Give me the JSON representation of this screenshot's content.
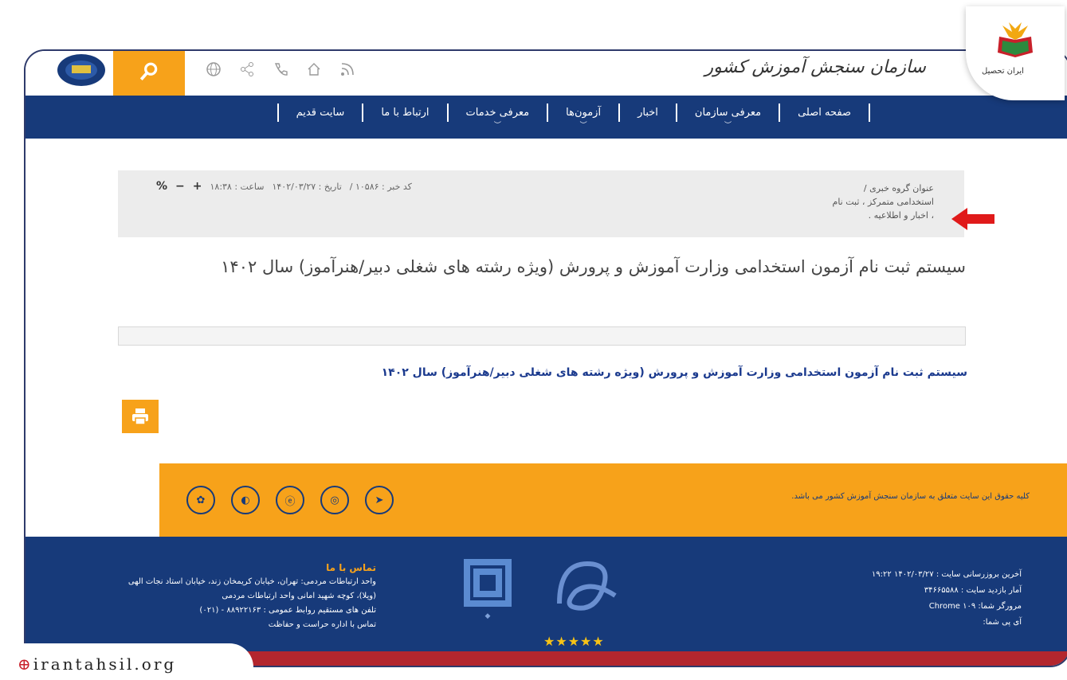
{
  "header": {
    "org_title": "سازمان سنجش آموزش کشور",
    "icons": [
      "globe-icon",
      "share-icon",
      "phone-icon",
      "home-icon",
      "rss-icon"
    ]
  },
  "nav": {
    "items": [
      {
        "label": "صفحه اصلی",
        "has_dropdown": false
      },
      {
        "label": "معرفی سازمان",
        "has_dropdown": true
      },
      {
        "label": "اخبار",
        "has_dropdown": false
      },
      {
        "label": "آزمون‌ها",
        "has_dropdown": true
      },
      {
        "label": "معرفی خدمات",
        "has_dropdown": true
      },
      {
        "label": "ارتباط با ما",
        "has_dropdown": false
      },
      {
        "label": "سایت قدیم",
        "has_dropdown": false
      }
    ]
  },
  "info": {
    "group_line1": "عنوان گروه خبری /",
    "group_line2": "استخدامی متمرکز ، ثبت نام",
    "group_line3": "، اخبار و اطلاعیه .",
    "news_code": "کد خبر : ۱۰۵۸۶ /",
    "date": "تاریخ : ۱۴۰۲/۰۳/۲۷",
    "time": "ساعت : ۱۸:۳۸"
  },
  "article": {
    "title": "سیستم ثبت نام آزمون استخدامی وزارت آموزش و پرورش (ویژه رشته های شغلی دبیر/هنرآموز) سال ۱۴۰۲",
    "link_text": "سیستم ثبت نام آزمون استخدامی وزارت آموزش و پرورش (ویژه رشته های شغلی دبیر/هنرآموز) سال ۱۴۰۲"
  },
  "footer": {
    "copyright": "کلیه حقوق این سایت متعلق به سازمان سنجش آموزش کشور می باشد.",
    "contact_title": "تماس با ما",
    "contact_line1": "واحد ارتباطات مردمی: تهران، خیابان کریمخان زند، خیابان استاد نجات الهی",
    "contact_line2": "(ویلا)، کوچه شهید امانی واحد ارتباطات مردمی",
    "contact_line3": "تلفن های مستقیم روابط عمومی : ۸۸۹۲۲۱۶۳ - (۰۲۱)",
    "contact_line4": "تماس با اداره حراست و حفاظت",
    "last_update": "آخرین بروزرسانی سایت : ۱۴۰۲/۰۳/۲۷ ۱۹:۲۲",
    "visits": "آمار بازدید سایت : ۳۴۶۶۵۵۸۸",
    "browser": "مرورگر شما: Chrome ۱۰۹",
    "ip": "آی پی شما:",
    "socials": [
      "telegram-icon",
      "instagram-icon",
      "eitaa-icon",
      "bale-icon",
      "soroush-icon"
    ]
  },
  "overlay": {
    "brand_name": "ایران تحصیل",
    "watermark": "irantahsil.org"
  },
  "colors": {
    "nav_blue": "#173a7a",
    "accent_orange": "#f7a21a",
    "arrow_red": "#e01a1a"
  }
}
